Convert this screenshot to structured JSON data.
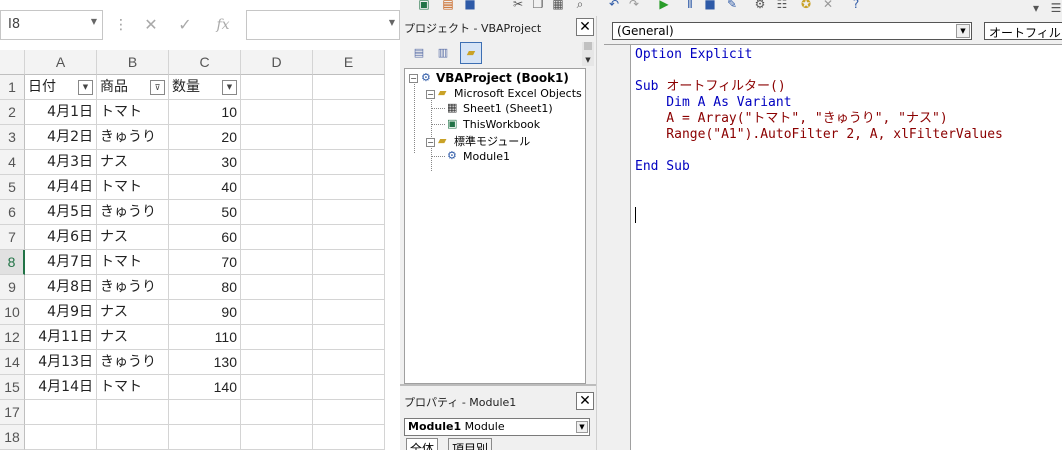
{
  "excel": {
    "name_box": "I8",
    "fx_label": "fx",
    "columns": [
      "A",
      "B",
      "C",
      "D",
      "E"
    ],
    "header_row": {
      "row": "1",
      "a": "日付",
      "b": "商品",
      "c": "数量"
    },
    "rows": [
      {
        "row": "2",
        "a": "4月1日",
        "b": "トマト",
        "c": "10"
      },
      {
        "row": "3",
        "a": "4月2日",
        "b": "きゅうり",
        "c": "20"
      },
      {
        "row": "4",
        "a": "4月3日",
        "b": "ナス",
        "c": "30"
      },
      {
        "row": "5",
        "a": "4月4日",
        "b": "トマト",
        "c": "40"
      },
      {
        "row": "6",
        "a": "4月5日",
        "b": "きゅうり",
        "c": "50"
      },
      {
        "row": "7",
        "a": "4月6日",
        "b": "ナス",
        "c": "60"
      },
      {
        "row": "8",
        "a": "4月7日",
        "b": "トマト",
        "c": "70"
      },
      {
        "row": "9",
        "a": "4月8日",
        "b": "きゅうり",
        "c": "80"
      },
      {
        "row": "10",
        "a": "4月9日",
        "b": "ナス",
        "c": "90"
      },
      {
        "row": "12",
        "a": "4月11日",
        "b": "ナス",
        "c": "110"
      },
      {
        "row": "14",
        "a": "4月13日",
        "b": "きゅうり",
        "c": "130"
      },
      {
        "row": "15",
        "a": "4月14日",
        "b": "トマト",
        "c": "140"
      },
      {
        "row": "17",
        "a": "",
        "b": "",
        "c": ""
      },
      {
        "row": "18",
        "a": "",
        "b": "",
        "c": ""
      }
    ],
    "selected_row": "8",
    "accent_color": "#217346"
  },
  "project": {
    "title": "プロジェクト - VBAProject",
    "root": "VBAProject (Book1)",
    "folder_objects": "Microsoft Excel Objects",
    "sheet": "Sheet1 (Sheet1)",
    "workbook": "ThisWorkbook",
    "folder_modules": "標準モジュール",
    "module": "Module1"
  },
  "properties": {
    "title": "プロパティ - Module1",
    "object_name": "Module1",
    "object_type": "Module",
    "tab_all": "全体",
    "tab_category": "項目別"
  },
  "code": {
    "object_combo": "(General)",
    "proc_combo": "オートフィルター",
    "lines": [
      [
        {
          "t": "Option Explicit",
          "c": "kw"
        }
      ],
      [],
      [
        {
          "t": "Sub ",
          "c": "kw"
        },
        {
          "t": "オートフィルター()",
          "c": "id"
        }
      ],
      [
        {
          "t": "    Dim A As Variant",
          "c": "kw"
        }
      ],
      [
        {
          "t": "    A = Array(\"トマト\", \"きゅうり\", \"ナス\")",
          "c": "id"
        }
      ],
      [
        {
          "t": "    Range(\"A1\").AutoFilter 2, A, xlFilterValues",
          "c": "id"
        }
      ],
      [],
      [
        {
          "t": "End Sub",
          "c": "kw"
        }
      ]
    ]
  }
}
